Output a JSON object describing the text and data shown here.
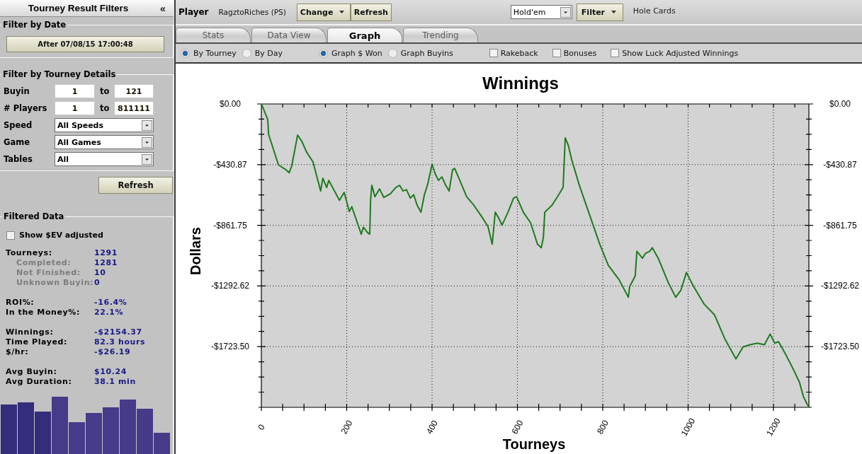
{
  "sidebar": {
    "title": "Tourney Result Filters",
    "collapse_glyph": "«",
    "date_filter": {
      "legend": "Filter by Date",
      "button": "After 07/08/15 17:00:48"
    },
    "details_filter": {
      "legend": "Filter by Tourney Details",
      "ranges": [
        {
          "label": "Buyin",
          "from": "1",
          "joiner": "to",
          "to": "121"
        },
        {
          "label": "# Players",
          "from": "1",
          "joiner": "to",
          "to": "811111"
        }
      ],
      "selects": [
        {
          "label": "Speed",
          "value": "All Speeds"
        },
        {
          "label": "Game",
          "value": "All Games"
        },
        {
          "label": "Tables",
          "value": "All"
        }
      ]
    },
    "refresh_button": "Refresh",
    "filtered_data": {
      "legend": "Filtered Data",
      "ev_checkbox": {
        "label": "Show $EV adjusted",
        "checked": false
      },
      "groups": [
        {
          "rows": [
            {
              "label": "Tourneys:",
              "value": "1291",
              "kind": "main"
            },
            {
              "label": "Completed:",
              "value": "1281",
              "kind": "sub"
            },
            {
              "label": "Not Finished:",
              "value": "10",
              "kind": "sub"
            },
            {
              "label": "Unknown Buyin:",
              "value": "0",
              "kind": "sub"
            }
          ]
        },
        {
          "rows": [
            {
              "label": "ROI%:",
              "value": "-16.4%",
              "kind": "main"
            },
            {
              "label": "In the Money%:",
              "value": "22.1%",
              "kind": "main"
            }
          ]
        },
        {
          "rows": [
            {
              "label": "Winnings:",
              "value": "-$2154.37",
              "kind": "main"
            },
            {
              "label": "Time Played:",
              "value": "82.3 hours",
              "kind": "main"
            },
            {
              "label": "$/hr:",
              "value": "-$26.19",
              "kind": "main"
            }
          ]
        },
        {
          "rows": [
            {
              "label": "Avg Buyin:",
              "value": "$10.24",
              "kind": "main"
            },
            {
              "label": "Avg Duration:",
              "value": "38.1 min",
              "kind": "main"
            }
          ]
        }
      ]
    }
  },
  "toolbar": {
    "player_label": "Player",
    "player_name": "RagztoRiches (PS)",
    "buttons": [
      {
        "label": "Change",
        "kind": "menu"
      },
      {
        "label": "Refresh",
        "kind": "plain"
      }
    ],
    "game_select": "Hold'em",
    "filter_button": {
      "label": "Filter",
      "kind": "menu"
    },
    "hole_cards_label": "Hole Cards"
  },
  "tabs": [
    {
      "label": "Stats",
      "selected": false
    },
    {
      "label": "Data View",
      "selected": false
    },
    {
      "label": "Graph",
      "selected": true
    },
    {
      "label": "Trending",
      "selected": false
    }
  ],
  "graph_options": {
    "modes": [
      {
        "label": "By Tourney",
        "selected": true
      },
      {
        "label": "By Day",
        "selected": false
      }
    ],
    "measures": [
      {
        "label": "Graph $ Won",
        "selected": true
      },
      {
        "label": "Graph Buyins",
        "selected": false
      }
    ],
    "checkboxes": [
      {
        "label": "Rakeback",
        "checked": false
      },
      {
        "label": "Bonuses",
        "checked": false
      },
      {
        "label": "Show Luck Adjusted Winnings",
        "checked": false
      }
    ]
  },
  "graph": {
    "right_axis_labels": [
      "$0.00",
      "-$430.87",
      "-$861.75",
      "-$1292.62",
      "-$1723.50"
    ],
    "chart_data": {
      "type": "line",
      "title": "Winnings",
      "xlabel": "Tourneys",
      "ylabel": "Dollars",
      "grid": true,
      "x": [
        0,
        5,
        15,
        17,
        40,
        50,
        58,
        65,
        71,
        85,
        95,
        106,
        121,
        139,
        144,
        153,
        158,
        183,
        194,
        206,
        212,
        234,
        239,
        249,
        254,
        256,
        259,
        266,
        277,
        287,
        302,
        315,
        324,
        332,
        340,
        349,
        357,
        365,
        374,
        382,
        390,
        400,
        407,
        415,
        423,
        432,
        440,
        448,
        453,
        465,
        481,
        498,
        515,
        531,
        541,
        548,
        556,
        564,
        578,
        591,
        598,
        614,
        631,
        647,
        656,
        661,
        664,
        681,
        697,
        707,
        712,
        719,
        727,
        744,
        767,
        793,
        813,
        838,
        860,
        863,
        876,
        880,
        893,
        900,
        910,
        916,
        930,
        954,
        971,
        983,
        996,
        1013,
        1038,
        1062,
        1087,
        1112,
        1129,
        1145,
        1162,
        1179,
        1192,
        1203,
        1212,
        1228,
        1245,
        1261,
        1270,
        1278,
        1283
      ],
      "series": [
        {
          "color": "#1e7a1e",
          "values": [
            0,
            -35,
            -111,
            -216,
            -432,
            -453,
            -468,
            -488,
            -442,
            -221,
            -266,
            -342,
            -412,
            -618,
            -528,
            -593,
            -543,
            -684,
            -628,
            -764,
            -729,
            -925,
            -875,
            -915,
            -925,
            -684,
            -578,
            -659,
            -603,
            -664,
            -639,
            -593,
            -578,
            -618,
            -608,
            -669,
            -644,
            -719,
            -769,
            -644,
            -568,
            -427,
            -493,
            -543,
            -518,
            -578,
            -618,
            -468,
            -458,
            -543,
            -659,
            -719,
            -794,
            -870,
            -996,
            -769,
            -810,
            -860,
            -769,
            -669,
            -659,
            -769,
            -845,
            -996,
            -1021,
            -945,
            -769,
            -719,
            -644,
            -593,
            -241,
            -292,
            -392,
            -568,
            -769,
            -996,
            -1146,
            -1247,
            -1373,
            -1297,
            -1222,
            -1046,
            -1096,
            -1061,
            -1046,
            -1021,
            -1096,
            -1272,
            -1373,
            -1322,
            -1197,
            -1297,
            -1423,
            -1498,
            -1674,
            -1810,
            -1725,
            -1710,
            -1699,
            -1710,
            -1634,
            -1699,
            -1689,
            -1775,
            -1875,
            -1976,
            -2077,
            -2127,
            -2150
          ]
        }
      ],
      "xlim": [
        0,
        1283
      ],
      "ylim": [
        -2154.37,
        0
      ],
      "xticks": [
        0,
        200,
        400,
        600,
        800,
        1000,
        1200
      ],
      "yticks": [
        {
          "value": 0,
          "label": "$0.00"
        },
        {
          "value": -430.87,
          "label": "-$430.87"
        },
        {
          "value": -861.75,
          "label": "-$861.75"
        },
        {
          "value": -1292.62,
          "label": "-$1292.62"
        },
        {
          "value": -1723.5,
          "label": "-$1723.50"
        }
      ]
    }
  }
}
